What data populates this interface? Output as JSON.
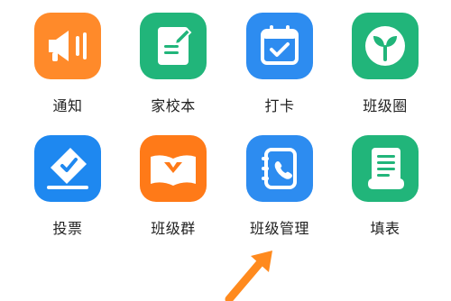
{
  "grid": {
    "row1": [
      {
        "label": "通知",
        "icon": "megaphone-icon",
        "color": "#FF8A2A"
      },
      {
        "label": "家校本",
        "icon": "notebook-pen-icon",
        "color": "#21B57A"
      },
      {
        "label": "打卡",
        "icon": "calendar-check-icon",
        "color": "#2D8CF0"
      },
      {
        "label": "班级圈",
        "icon": "sprout-icon",
        "color": "#21B57A"
      }
    ],
    "row2": [
      {
        "label": "投票",
        "icon": "ballot-box-icon",
        "color": "#1E88F0"
      },
      {
        "label": "班级群",
        "icon": "open-book-icon",
        "color": "#FF7A18"
      },
      {
        "label": "班级管理",
        "icon": "contact-book-icon",
        "color": "#2D8CF0"
      },
      {
        "label": "填表",
        "icon": "scroll-form-icon",
        "color": "#21B57A"
      }
    ]
  },
  "annotation": {
    "arrow_color": "#FF8A1E"
  }
}
